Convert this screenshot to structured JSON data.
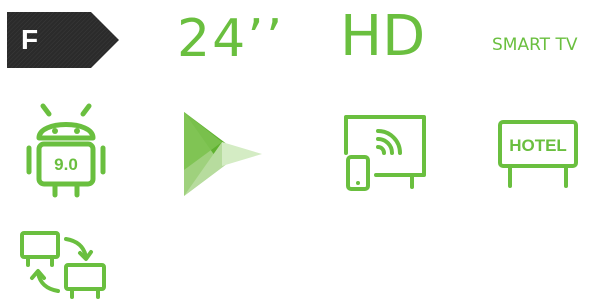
{
  "energy_class": {
    "label": "F",
    "color": "#2b2b2b"
  },
  "specs": {
    "screen_size": "24’’",
    "resolution": "HD",
    "smart": "SMART TV"
  },
  "features": {
    "android": {
      "icon": "android-robot-icon",
      "version": "9.0"
    },
    "play_store": {
      "icon": "play-store-icon"
    },
    "screen_mirroring": {
      "icon": "screen-mirroring-icon"
    },
    "hotel_mode": {
      "icon": "hotel-sign-icon",
      "label": "HOTEL"
    },
    "multi_screen": {
      "icon": "screen-switch-icon"
    }
  },
  "colors": {
    "accent_green": "#6abf3f",
    "badge_dark": "#2b2b2b",
    "play_light": "#c5e4b0",
    "play_mid": "#9fd17d",
    "play_dark": "#5fb12f"
  }
}
